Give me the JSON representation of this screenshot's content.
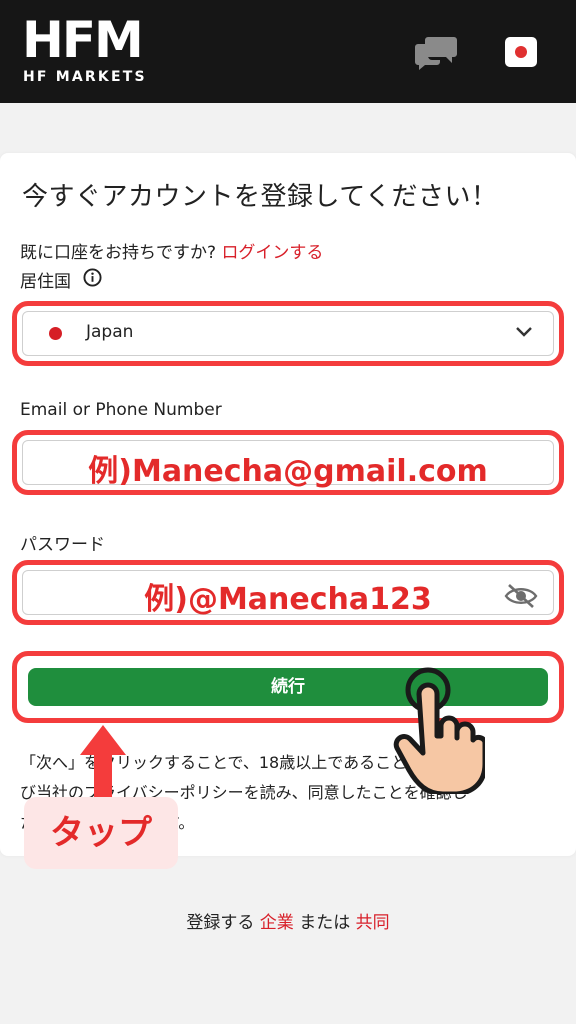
{
  "header": {
    "logo_text": "HFM",
    "logo_subtitle": "HF MARKETS",
    "chat_icon": "chat-bubbles-icon",
    "flag_icon": "japan-flag-icon"
  },
  "form": {
    "title": "今すぐアカウントを登録してください！",
    "login_question": "既に口座をお持ちですか?",
    "login_link": "ログインする",
    "country_label": "居住国",
    "country_value": "Japan",
    "email_label": "Email or Phone Number",
    "email_example": "例)Manecha@gmail.com",
    "password_label": "パスワード",
    "password_example": "例)@Manecha123",
    "continue_label": "続行",
    "terms_line1": "「次へ」をクリックすることで、18歳以上であること、およ",
    "terms_line2": "び当社のプライバシーポリシーを読み、同意したことを確認し",
    "terms_line3": "たものとみなされます。"
  },
  "annotation": {
    "tap_label": "タップ"
  },
  "footer": {
    "prefix": "登録する",
    "corporate": "企業",
    "or": "または",
    "joint": "共同"
  },
  "colors": {
    "brand_red": "#d8202a",
    "highlight_red": "#f43c3c",
    "button_green": "#1f8e3d",
    "header_bg": "#161616"
  }
}
